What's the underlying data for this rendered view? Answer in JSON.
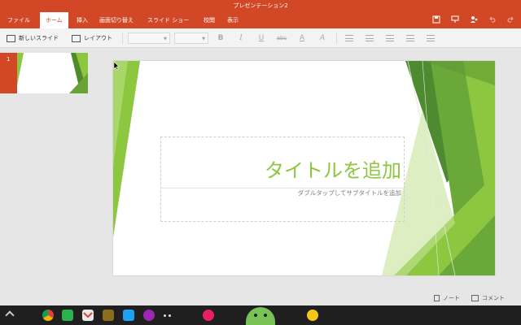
{
  "window": {
    "title": "プレゼンテーション2"
  },
  "tabs": [
    "ファイル",
    "ホーム",
    "挿入",
    "画面切り替え",
    "スライド ショー",
    "校閲",
    "表示"
  ],
  "active_tab": "ホーム",
  "title_icons": [
    "save-icon",
    "present-icon",
    "share-icon",
    "undo-icon",
    "redo-icon"
  ],
  "toolbar": {
    "new_slide_label": "新しいスライド",
    "layout_label": "レイアウト",
    "bold": "B",
    "italic": "I",
    "underline": "U",
    "strikethrough": "abc",
    "font_color": "A",
    "clear_format": "A"
  },
  "thumbnails": [
    {
      "number": "1"
    }
  ],
  "slide": {
    "title_placeholder": "タイトルを追加",
    "subtitle_placeholder": "ダブルタップしてサブタイトルを追加"
  },
  "bottom": {
    "notes_label": "ノート",
    "comments_label": "コメント"
  },
  "taskbar_apps": [
    "chrome-icon",
    "feedly-icon",
    "gmail-icon",
    "app-icon",
    "twitter-icon",
    "music-icon",
    "more-dots-icon",
    "pink-app-icon",
    "android-icon",
    "yellow-app-icon"
  ],
  "colors": {
    "accent": "#d24726",
    "slide_green": "#8dc63f",
    "taskbar": "#1f1f1f"
  }
}
